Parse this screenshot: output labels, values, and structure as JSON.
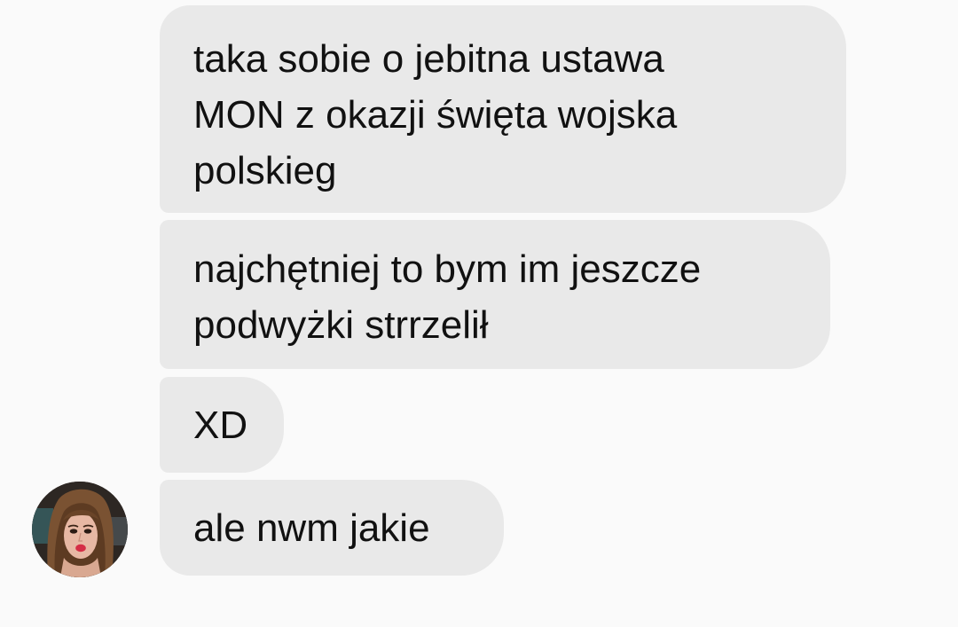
{
  "conversation": {
    "messages": [
      {
        "text": "taka sobie o jebitna ustawa\nMON z okazji święta wojska\npolskieg"
      },
      {
        "text": "najchętniej to bym im jeszcze\npodwyżki strrzelił"
      },
      {
        "text": "XD"
      },
      {
        "text": "ale nwm jakie"
      }
    ],
    "sender": {
      "avatar_icon": "profile-photo-avatar"
    }
  },
  "colors": {
    "background": "#fafafa",
    "bubble": "#e9e9e9",
    "text": "#111111"
  }
}
